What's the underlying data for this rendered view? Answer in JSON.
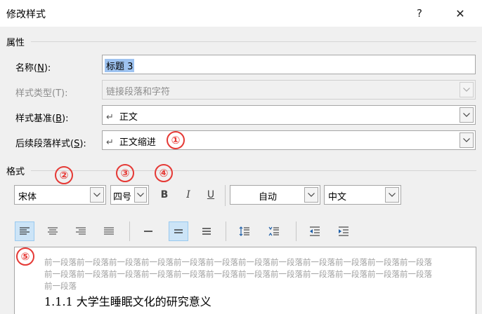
{
  "dialog": {
    "title": "修改样式",
    "help_glyph": "?",
    "close_glyph": "✕"
  },
  "properties": {
    "section_label": "属性",
    "name": {
      "label_pre": "名称(",
      "label_key": "N",
      "label_post": "):",
      "value": "标题 3"
    },
    "style_type": {
      "label": "样式类型(T):",
      "value": "链接段落和字符",
      "disabled": true
    },
    "based_on": {
      "label_pre": "样式基准(",
      "label_key": "B",
      "label_post": "):",
      "value": "正文"
    },
    "following": {
      "label_pre": "后续段落样式(",
      "label_key": "S",
      "label_post": "):",
      "value": "正文缩进"
    },
    "return_glyph": "↵"
  },
  "format": {
    "section_label": "格式",
    "font": "宋体",
    "size": "四号",
    "bold": "B",
    "italic": "I",
    "underline": "U",
    "color": "自动",
    "script": "中文"
  },
  "badges": [
    "①",
    "②",
    "③",
    "④",
    "⑤"
  ],
  "preview": {
    "prev_paragraph": "前一段落前一段落前一段落前一段落前一段落前一段落前一段落前一段落前一段落前一段落前一段落前一段落前一段落前一段落前一段落前一段落前一段落前一段落前一段落前一段落前一段落前一段落前一段落前一段落前一段落",
    "heading": "1.1.1 大学生睡眠文化的研究意义"
  },
  "colors": {
    "badge": "#e53935",
    "active_button": "#cce4f7",
    "selection": "#9ec3f0"
  }
}
